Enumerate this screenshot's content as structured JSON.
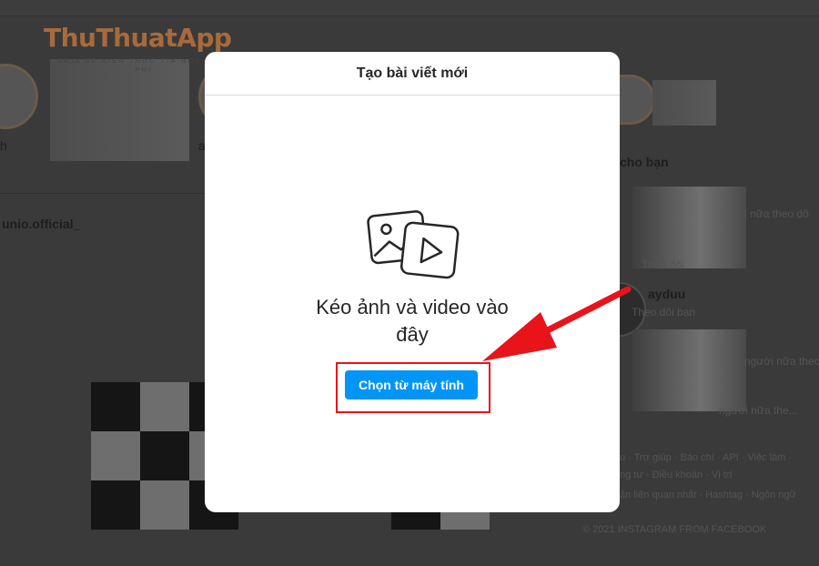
{
  "watermark": {
    "title": "ThuThuatApp",
    "subtitle": "CHIA SẺ KIẾN THỨC TIN HỌC HIỆN PHI"
  },
  "background": {
    "story_label_left": "h",
    "story_label_mid": "a",
    "post_username": "unio.official_",
    "suggestions_heading": "cho bạn",
    "suggestion_1_meta": "i nữa theo dõ",
    "suggestion_1_sub": "Theo dõi",
    "suggestion_2_name": "ayduu",
    "suggestion_2_sub": "Theo dõi bạn",
    "suggestion_3_meta": "người nữa theo",
    "suggestion_3_sub": "người nữa the...",
    "footer_links_1": "u · Trợ giúp · Báo chí · API · Việc làm ·",
    "footer_links_2": "ng tư · Điều khoản · Vị trí",
    "footer_links_3": "ản liên quan nhất · Hashtag · Ngôn ngữ",
    "copyright": "© 2021 INSTAGRAM FROM FACEBOOK"
  },
  "modal": {
    "title": "Tạo bài viết mới",
    "drop_text_line1": "Kéo ảnh và video vào",
    "drop_text_line2": "đây",
    "select_button": "Chọn từ máy tính",
    "icon": "photo-video-icon"
  },
  "colors": {
    "primary_button": "#0095f6",
    "highlight": "#e8141a",
    "overlay": "#3a3a3a",
    "watermark": "#a86a3c"
  }
}
